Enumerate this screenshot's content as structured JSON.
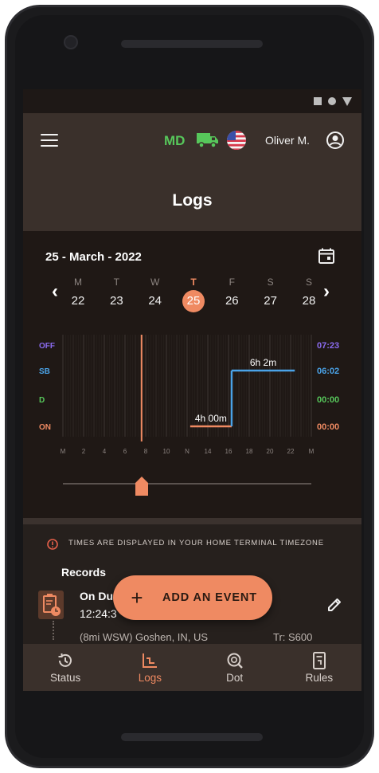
{
  "header": {
    "state_code": "MD",
    "user_name": "Oliver M.",
    "title": "Logs"
  },
  "calendar": {
    "date_label": "25 - March - 2022",
    "days": [
      {
        "letter": "M",
        "num": "22",
        "selected": false
      },
      {
        "letter": "T",
        "num": "23",
        "selected": false
      },
      {
        "letter": "W",
        "num": "24",
        "selected": false
      },
      {
        "letter": "T",
        "num": "25",
        "selected": true
      },
      {
        "letter": "F",
        "num": "26",
        "selected": false
      },
      {
        "letter": "S",
        "num": "27",
        "selected": false
      },
      {
        "letter": "S",
        "num": "28",
        "selected": false
      }
    ]
  },
  "chart_data": {
    "type": "line",
    "rows": [
      "OFF",
      "SB",
      "D",
      "ON"
    ],
    "row_colors": {
      "OFF": "#8b6cf0",
      "SB": "#4aa3e8",
      "D": "#57c75b",
      "ON": "#ef8a62"
    },
    "totals": {
      "OFF": "07:23",
      "SB": "06:02",
      "D": "00:00",
      "ON": "00:00"
    },
    "x_tick_labels": [
      "M",
      "2",
      "4",
      "6",
      "8",
      "10",
      "N",
      "14",
      "16",
      "18",
      "20",
      "22",
      "M"
    ],
    "current_hour": 7.6,
    "segments": [
      {
        "status": "ON",
        "start": 12.3,
        "end": 16.3,
        "label": "4h 00m"
      },
      {
        "status": "SB",
        "start": 16.3,
        "end": 22.4,
        "label": "6h 2m"
      }
    ]
  },
  "slider": {
    "value": 7.6,
    "max": 24
  },
  "notice": "TIMES ARE DISPLAYED IN YOUR HOME TERMINAL TIMEZONE",
  "records": {
    "title": "Records",
    "items": [
      {
        "status": "On Du",
        "time": "12:24:3",
        "location": "(8mi WSW) Goshen, IN, US",
        "trailer": "Tr: S600"
      }
    ]
  },
  "fab": {
    "plus": "+",
    "label": "ADD AN EVENT"
  },
  "nav": [
    {
      "label": "Status",
      "icon": "history-icon",
      "active": false
    },
    {
      "label": "Logs",
      "icon": "chart-icon",
      "active": true
    },
    {
      "label": "Dot",
      "icon": "dot-inspection-icon",
      "active": false
    },
    {
      "label": "Rules",
      "icon": "rules-document-icon",
      "active": false
    }
  ],
  "colors": {
    "accent": "#ef8a62",
    "green": "#57c75b",
    "panel": "#1f1815"
  }
}
